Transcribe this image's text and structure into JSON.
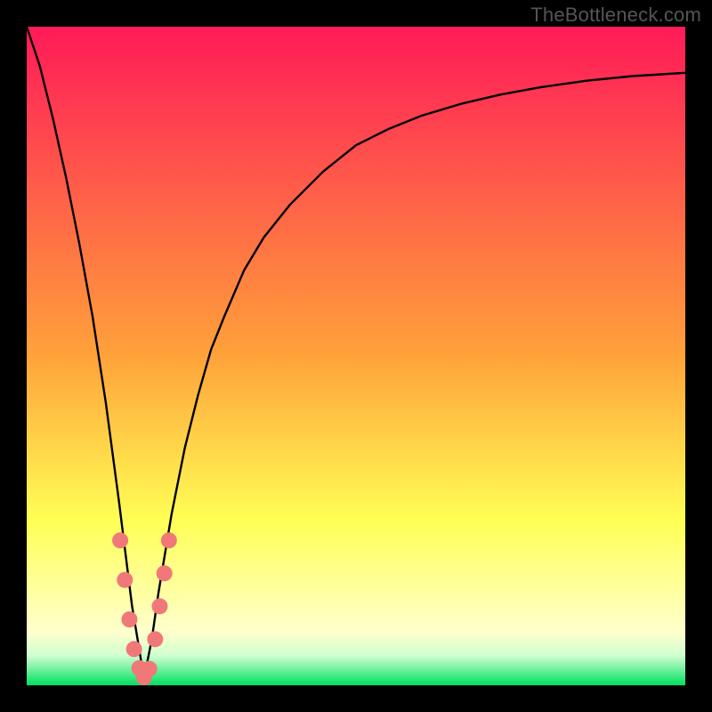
{
  "watermark": "TheBottleneck.com",
  "chart_data": {
    "type": "line",
    "title": "",
    "xlabel": "",
    "ylabel": "",
    "xlim": [
      0,
      100
    ],
    "ylim": [
      0,
      100
    ],
    "grid": false,
    "legend": false,
    "background_gradient": {
      "stops": [
        {
          "pct": 0.0,
          "color": "#ff1a58"
        },
        {
          "pct": 0.5,
          "color": "#ffa23a"
        },
        {
          "pct": 0.75,
          "color": "#ffff55"
        },
        {
          "pct": 0.92,
          "color": "#ffffcd"
        },
        {
          "pct": 0.955,
          "color": "#d0ffd0"
        },
        {
          "pct": 1.0,
          "color": "#00e060"
        }
      ]
    },
    "series": [
      {
        "name": "left-branch",
        "x": [
          0,
          2,
          4,
          6,
          8,
          10,
          12,
          14,
          15,
          16,
          17,
          17.8
        ],
        "values": [
          100,
          94,
          86,
          77,
          67,
          56,
          43,
          28,
          20,
          12,
          6,
          1
        ]
      },
      {
        "name": "right-branch",
        "x": [
          17.8,
          19,
          20,
          22,
          24,
          26,
          28,
          30,
          33,
          36,
          40,
          45,
          50,
          55,
          60,
          66,
          72,
          78,
          85,
          92,
          100
        ],
        "values": [
          1,
          7,
          14,
          26,
          36,
          44,
          51,
          56,
          63,
          68,
          73,
          78,
          82,
          84.5,
          86.5,
          88.3,
          89.7,
          90.8,
          91.8,
          92.5,
          93
        ]
      }
    ],
    "scatter": {
      "name": "data-points",
      "color": "#f07878",
      "points": [
        {
          "x": 14.2,
          "y": 22
        },
        {
          "x": 14.9,
          "y": 16
        },
        {
          "x": 15.6,
          "y": 10
        },
        {
          "x": 16.3,
          "y": 5.5
        },
        {
          "x": 17.1,
          "y": 2.6
        },
        {
          "x": 17.8,
          "y": 1.2
        },
        {
          "x": 18.6,
          "y": 2.5
        },
        {
          "x": 19.5,
          "y": 7
        },
        {
          "x": 20.2,
          "y": 12
        },
        {
          "x": 20.9,
          "y": 17
        },
        {
          "x": 21.6,
          "y": 22
        }
      ]
    }
  }
}
